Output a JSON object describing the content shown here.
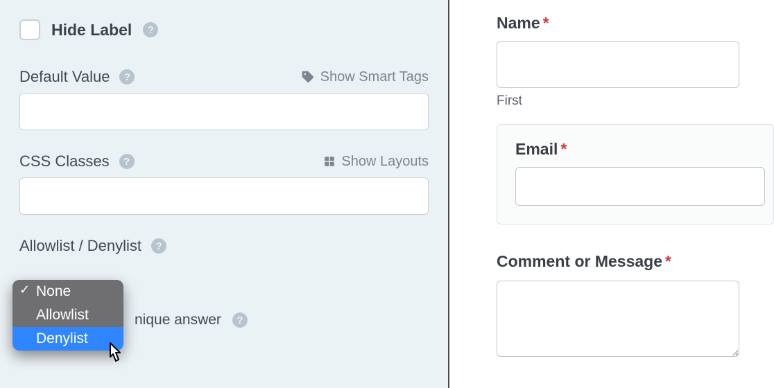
{
  "settings": {
    "hide_label": {
      "label": "Hide Label"
    },
    "default_value": {
      "label": "Default Value",
      "smart_tags_label": "Show Smart Tags",
      "value": ""
    },
    "css_classes": {
      "label": "CSS Classes",
      "layouts_label": "Show Layouts",
      "value": ""
    },
    "allowlist": {
      "label": "Allowlist / Denylist",
      "options": [
        "None",
        "Allowlist",
        "Denylist"
      ],
      "selected": "None",
      "hover": "Denylist"
    },
    "unique_answer_suffix": "nique answer"
  },
  "preview": {
    "name": {
      "label": "Name",
      "required": true,
      "sublabel": "First",
      "value": ""
    },
    "email": {
      "label": "Email",
      "required": true,
      "value": ""
    },
    "comment": {
      "label": "Comment or Message",
      "required": true,
      "value": ""
    }
  }
}
